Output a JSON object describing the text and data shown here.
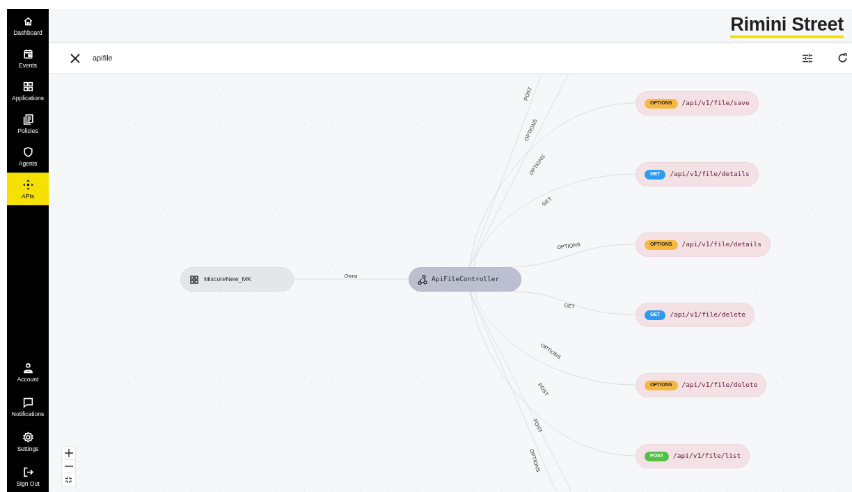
{
  "sidebar": {
    "items": [
      {
        "label": "Dashboard",
        "selected": false
      },
      {
        "label": "Events",
        "selected": false
      },
      {
        "label": "Applications",
        "selected": false
      },
      {
        "label": "Policies",
        "selected": false
      },
      {
        "label": "Agents",
        "selected": false
      },
      {
        "label": "APIs",
        "selected": true
      }
    ],
    "bottom_items": [
      {
        "label": "Account"
      },
      {
        "label": "Notifications"
      },
      {
        "label": "Settings"
      },
      {
        "label": "Sign Out"
      }
    ]
  },
  "header": {
    "logo": "Rimini Street"
  },
  "search": {
    "value": "apifile"
  },
  "graph": {
    "application": {
      "name": "MixcoreNew_MK",
      "edge_label": "Owns"
    },
    "controller": {
      "name": "ApiFileController"
    },
    "offscreen_edges_top": [
      "POST",
      "OPTIONS"
    ],
    "endpoints": [
      {
        "method": "OPTIONS",
        "color": "#f5b942",
        "path": "/api/v1/file/save",
        "edge_label": "OPTIONS"
      },
      {
        "method": "GET",
        "color": "#2d9cf0",
        "path": "/api/v1/file/details",
        "edge_label": "GET"
      },
      {
        "method": "OPTIONS",
        "color": "#f5b942",
        "path": "/api/v1/file/details",
        "edge_label": "OPTIONS"
      },
      {
        "method": "GET",
        "color": "#2d9cf0",
        "path": "/api/v1/file/delete",
        "edge_label": "GET"
      },
      {
        "method": "OPTIONS",
        "color": "#f5b942",
        "path": "/api/v1/file/delete",
        "edge_label": "OPTIONS"
      },
      {
        "method": "POST",
        "color": "#52c043",
        "path": "/api/v1/file/list",
        "edge_label": "POST"
      }
    ],
    "offscreen_edges_bottom": [
      "POST",
      "OPTIONS"
    ]
  }
}
